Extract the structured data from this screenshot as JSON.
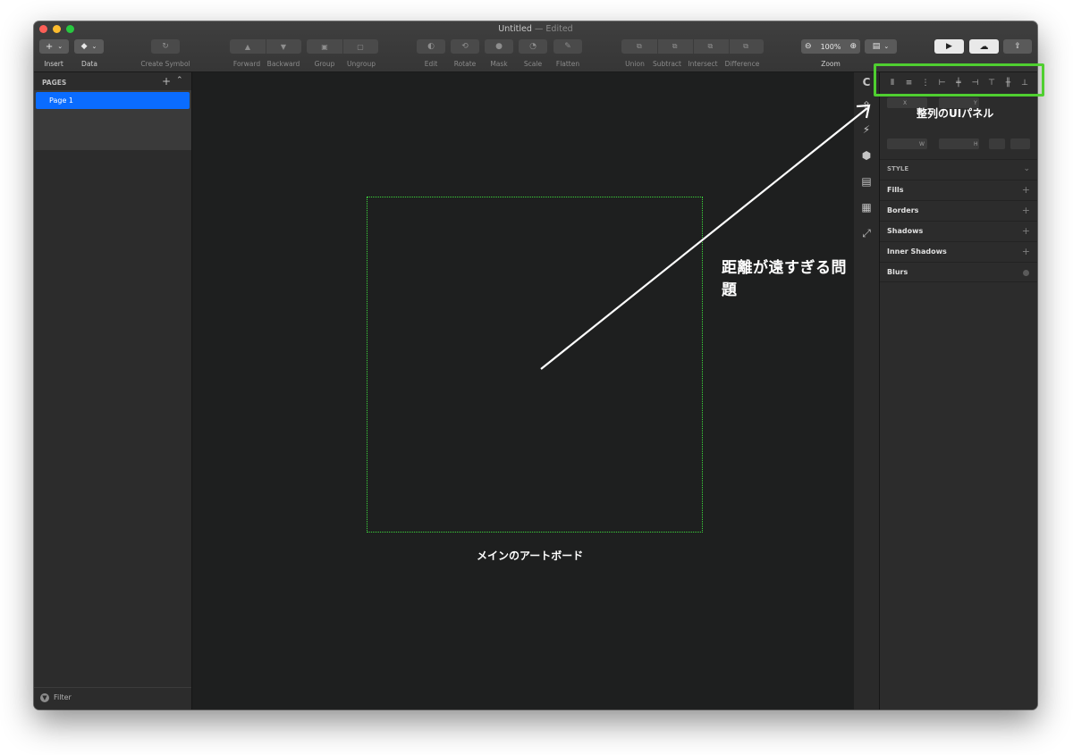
{
  "window": {
    "title": "Untitled",
    "edited_suffix": "— Edited"
  },
  "toolbar": {
    "insert_label": "Insert",
    "data_label": "Data",
    "create_symbol_label": "Create Symbol",
    "forward_label": "Forward",
    "backward_label": "Backward",
    "group_label": "Group",
    "ungroup_label": "Ungroup",
    "edit_label": "Edit",
    "rotate_label": "Rotate",
    "mask_label": "Mask",
    "scale_label": "Scale",
    "flatten_label": "Flatten",
    "union_label": "Union",
    "subtract_label": "Subtract",
    "intersect_label": "Intersect",
    "difference_label": "Difference",
    "zoom_label": "Zoom",
    "zoom_value": "100%"
  },
  "sidebar": {
    "pages_header": "PAGES",
    "pages": [
      {
        "label": "Page 1",
        "selected": true
      }
    ],
    "filter_label": "Filter"
  },
  "inspector": {
    "x_label": "X",
    "y_label": "Y",
    "w_label": "W",
    "h_label": "H",
    "style_header": "STYLE",
    "sections": [
      {
        "label": "Fills",
        "action": "+"
      },
      {
        "label": "Borders",
        "action": "+"
      },
      {
        "label": "Shadows",
        "action": "+"
      },
      {
        "label": "Inner Shadows",
        "action": "+"
      },
      {
        "label": "Blurs",
        "action": "toggle"
      }
    ]
  },
  "annotations": {
    "panel_label": "整列のUIパネル",
    "distance_label": "距離が遠すぎる問題",
    "artboard_label": "メインのアートボード",
    "highlight_color": "#4fcf30"
  },
  "colors": {
    "accent": "#0a6cff",
    "artboard_border": "#3cd83c"
  }
}
